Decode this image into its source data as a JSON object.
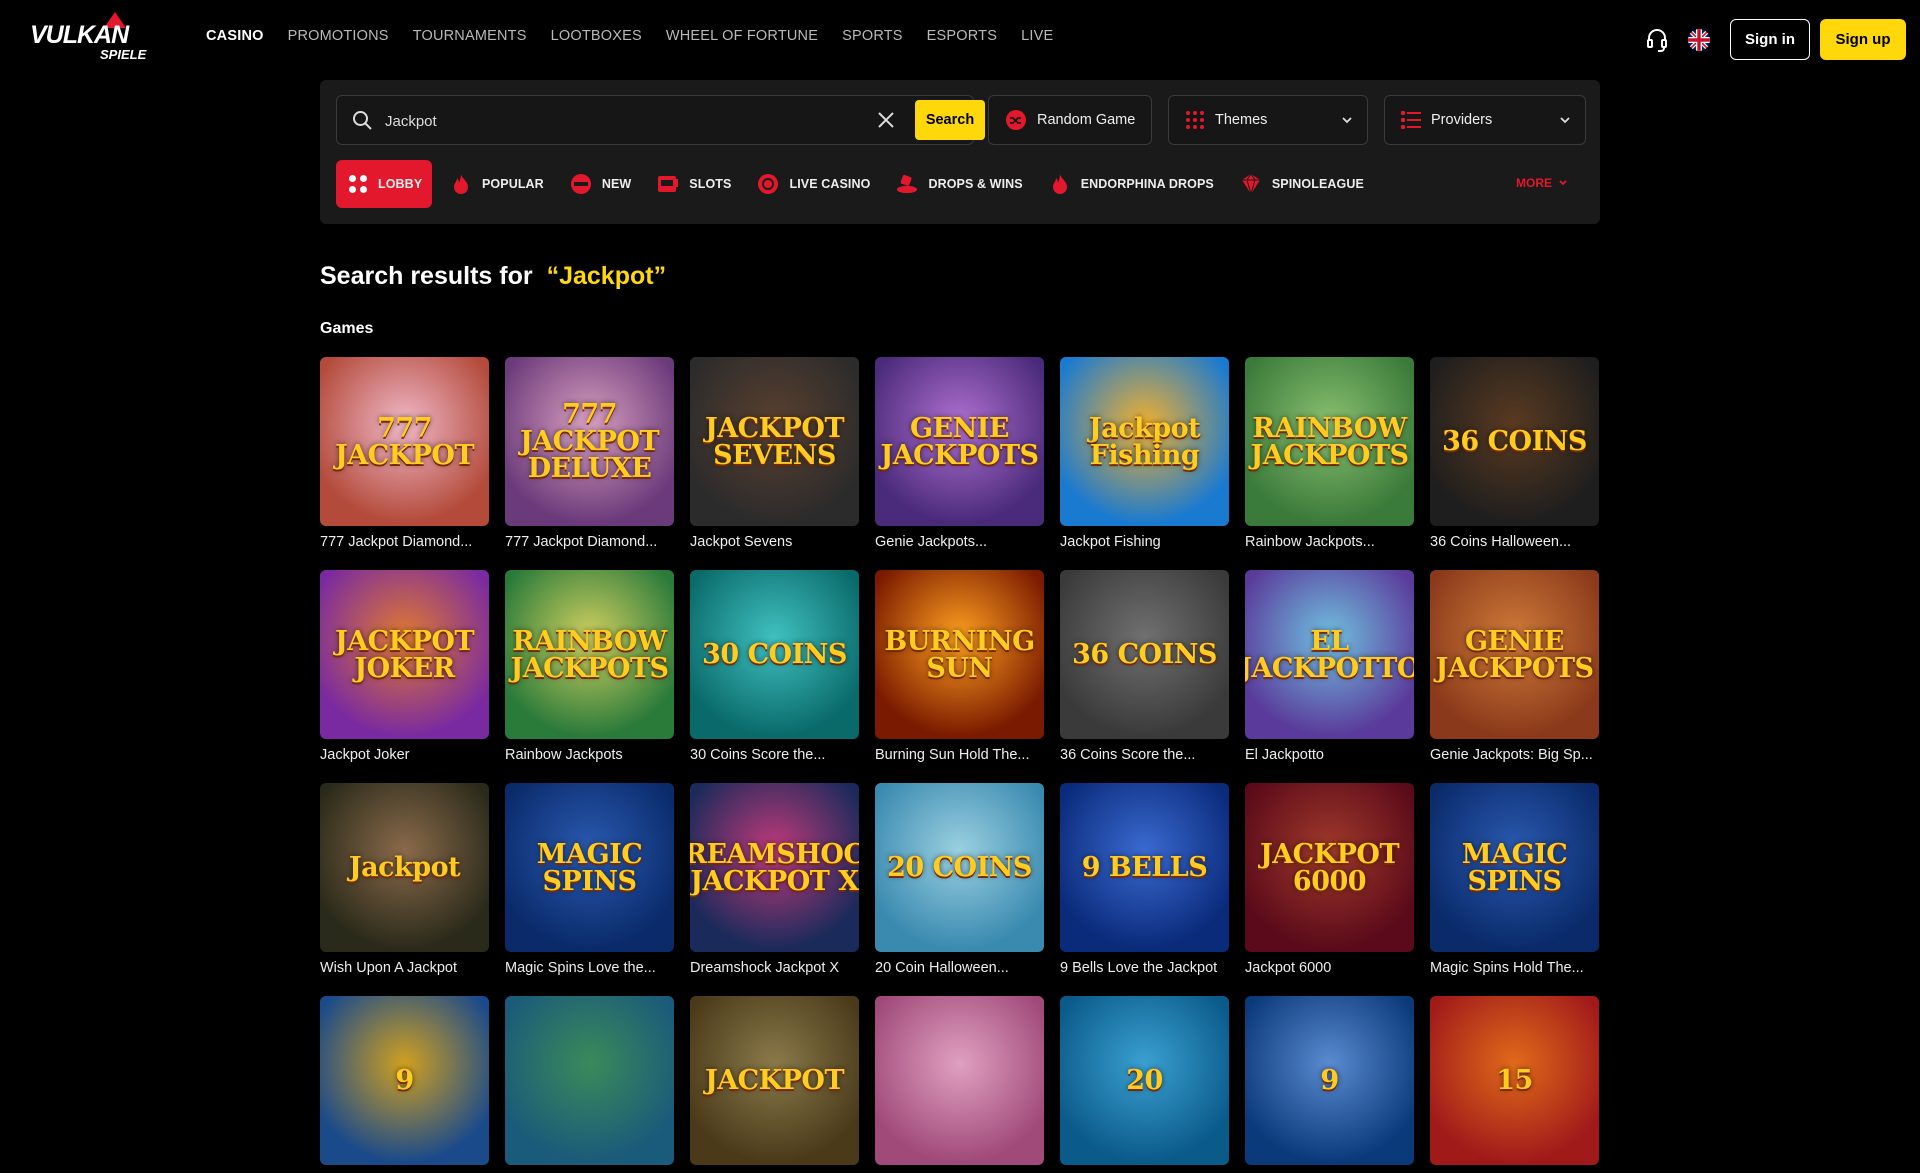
{
  "header": {
    "logo_top": "VULKAN",
    "logo_bottom": "SPIELE",
    "nav": [
      "CASINO",
      "PROMOTIONS",
      "TOURNAMENTS",
      "LOOTBOXES",
      "WHEEL OF FORTUNE",
      "SPORTS",
      "ESPORTS",
      "LIVE"
    ],
    "active_nav": "CASINO",
    "signin_label": "Sign in",
    "signup_label": "Sign up"
  },
  "search": {
    "value": "Jackpot",
    "button_label": "Search",
    "random_label": "Random Game",
    "themes_label": "Themes",
    "providers_label": "Providers"
  },
  "categories": [
    "LOBBY",
    "POPULAR",
    "NEW",
    "SLOTS",
    "LIVE CASINO",
    "DROPS & WINS",
    "ENDORPHINA DROPS",
    "SPINOLEAGUE"
  ],
  "more_label": "MORE",
  "results": {
    "title_prefix": "Search results for",
    "query_display": "“Jackpot”",
    "games_label": "Games"
  },
  "games": [
    {
      "name": "777 Jackpot Diamond...",
      "art": "777 JACKPOT",
      "bg": "#b34a3a",
      "bg2": "#f0b8c8"
    },
    {
      "name": "777 Jackpot Diamond...",
      "art": "777 JACKPOT DELUXE",
      "bg": "#6b3a7a",
      "bg2": "#d9a0c0"
    },
    {
      "name": "Jackpot Sevens",
      "art": "JACKPOT SEVENS",
      "bg": "#2b2b2b",
      "bg2": "#5a4030"
    },
    {
      "name": "Genie Jackpots...",
      "art": "GENIE JACKPOTS",
      "bg": "#4a2a7a",
      "bg2": "#b070d0"
    },
    {
      "name": "Jackpot Fishing",
      "art": "Jackpot Fishing",
      "bg": "#1a7ad0",
      "bg2": "#f0b030"
    },
    {
      "name": "Rainbow Jackpots...",
      "art": "RAINBOW JACKPOTS",
      "bg": "#3a7a3a",
      "bg2": "#8ac070"
    },
    {
      "name": "36 Coins Halloween...",
      "art": "36 COINS",
      "bg": "#1e1e1e",
      "bg2": "#5a3a20"
    },
    {
      "name": "Jackpot Joker",
      "art": "JACKPOT JOKER",
      "bg": "#7a2aa0",
      "bg2": "#e07a30"
    },
    {
      "name": "Rainbow Jackpots",
      "art": "RAINBOW JACKPOTS",
      "bg": "#2a7a3a",
      "bg2": "#d0d060"
    },
    {
      "name": "30 Coins Score the...",
      "art": "30 COINS",
      "bg": "#0a6a6a",
      "bg2": "#40c0c0"
    },
    {
      "name": "Burning Sun Hold The...",
      "art": "BURNING SUN",
      "bg": "#7a1a00",
      "bg2": "#ffa020"
    },
    {
      "name": "36 Coins Score the...",
      "art": "36 COINS",
      "bg": "#3a3a3a",
      "bg2": "#707070"
    },
    {
      "name": "El Jackpotto",
      "art": "EL JACKPOTTO",
      "bg": "#5a3a9a",
      "bg2": "#70c0e0"
    },
    {
      "name": "Genie Jackpots: Big Sp...",
      "art": "GENIE JACKPOTS",
      "bg": "#8a3a1a",
      "bg2": "#d07a3a"
    },
    {
      "name": "Wish Upon A Jackpot",
      "art": "Jackpot",
      "bg": "#2a2a1a",
      "bg2": "#8a6a4a"
    },
    {
      "name": "Magic Spins Love the...",
      "art": "MAGIC SPINS",
      "bg": "#0a2a6a",
      "bg2": "#2a5ab0"
    },
    {
      "name": "Dreamshock Jackpot X",
      "art": "DREAMSHOCK JACKPOT X",
      "bg": "#1a2a5a",
      "bg2": "#c03a7a"
    },
    {
      "name": "20 Coin Halloween...",
      "art": "20 COINS",
      "bg": "#3a8ab0",
      "bg2": "#9ad0e0"
    },
    {
      "name": "9 Bells Love the Jackpot",
      "art": "9 BELLS",
      "bg": "#0a2a7a",
      "bg2": "#3a6ad0"
    },
    {
      "name": "Jackpot 6000",
      "art": "JACKPOT 6000",
      "bg": "#5a0a1a",
      "bg2": "#a03a2a"
    },
    {
      "name": "Magic Spins Hold The...",
      "art": "MAGIC SPINS",
      "bg": "#0a2a6a",
      "bg2": "#2a5ab0"
    },
    {
      "name": "",
      "art": "9",
      "bg": "#1a4a8a",
      "bg2": "#d0a020"
    },
    {
      "name": "",
      "art": "",
      "bg": "#1a5a7a",
      "bg2": "#3a8a5a"
    },
    {
      "name": "",
      "art": "JACKPOT",
      "bg": "#4a3a1a",
      "bg2": "#8a7a4a"
    },
    {
      "name": "",
      "art": "",
      "bg": "#a04a7a",
      "bg2": "#e0a0c0"
    },
    {
      "name": "",
      "art": "20",
      "bg": "#0a5a8a",
      "bg2": "#3aa0d0"
    },
    {
      "name": "",
      "art": "9",
      "bg": "#0a3a7a",
      "bg2": "#5a8ad0"
    },
    {
      "name": "",
      "art": "15",
      "bg": "#a01a1a",
      "bg2": "#e06a1a"
    }
  ],
  "colors": {
    "accent_red": "#e3182d",
    "accent_yellow": "#ffd80c",
    "panel_bg": "#1a1a1a",
    "page_bg": "#000000"
  }
}
